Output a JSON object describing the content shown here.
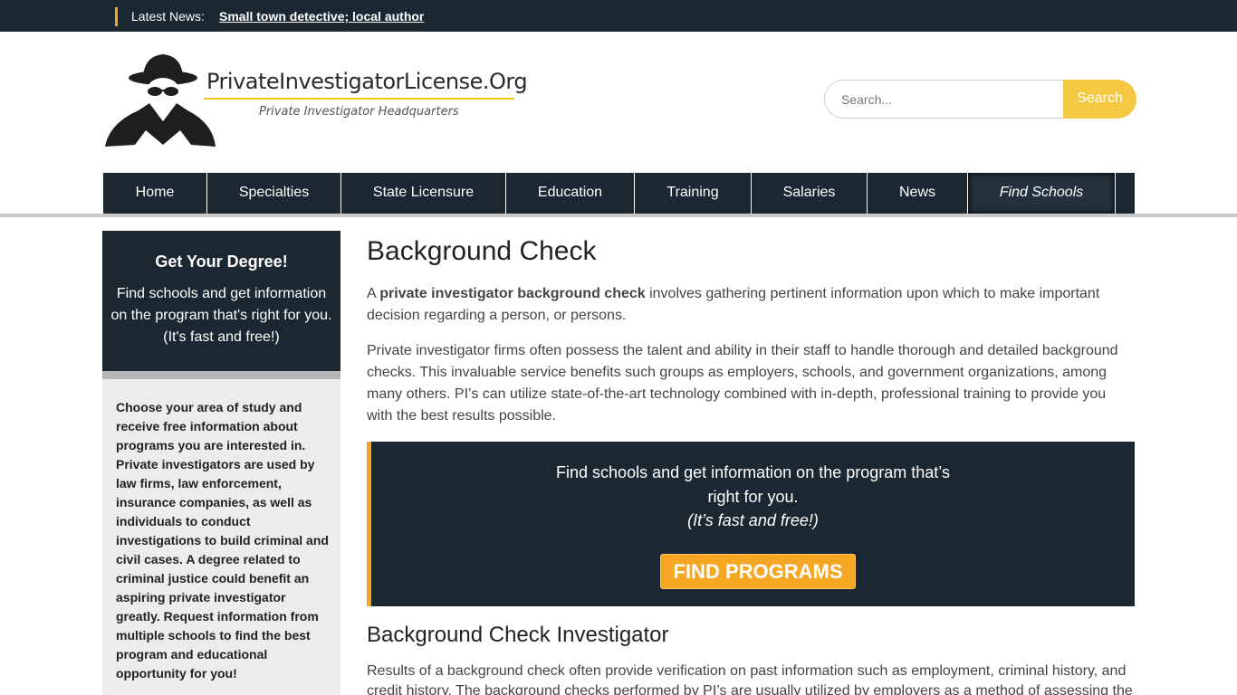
{
  "newsbar": {
    "label": "Latest News:",
    "headline": "Small town detective; local author"
  },
  "header": {
    "logo_title": "PrivateInvestigatorLicense.Org",
    "logo_tagline": "Private Investigator Headquarters",
    "search_placeholder": "Search...",
    "search_button": "Search"
  },
  "nav": {
    "items": [
      "Home",
      "Specialties",
      "State Licensure",
      "Education",
      "Training",
      "Salaries",
      "News",
      "Find Schools"
    ]
  },
  "sidebar": {
    "heading": "Get Your Degree!",
    "subtext": "Find schools and get information on the program that's right for you. (It's fast and free!)",
    "body": "Choose your area of study and receive free information about programs you are interested in. Private investigators are used by law firms, law enforcement, insurance companies, as well as individuals to conduct investigations to build criminal and civil cases. A degree related to criminal justice could benefit an aspiring private investigator greatly. Request information from multiple schools to find the best program and educational opportunity for you!"
  },
  "main": {
    "title": "Background Check",
    "p1_prefix": "A ",
    "p1_bold": "private investigator background check",
    "p1_suffix": " involves gathering pertinent information upon which to make important decision regarding a person, or persons.",
    "p2": "Private investigator firms often possess the talent and ability in their staff to handle thorough and detailed background checks. This invaluable service benefits such groups as employers, schools, and government organizations, among many others. PI’s can utilize state-of-the-art technology combined with in-depth, professional training to provide you with the best results possible.",
    "cta_line1": "Find schools and get information on the program that’s",
    "cta_line2": "right for you.",
    "cta_italic": "(It’s fast and free!)",
    "cta_button": "FIND PROGRAMS",
    "subheading": "Background Check Investigator",
    "p3": "Results of a background check often provide verification on past information such as employment, criminal history, and credit history. The background checks performed by PI’s are usually utilized by employers as a method of assessing the"
  },
  "colors": {
    "dark": "#1c2831",
    "accent_orange": "#f5a623",
    "search_yellow": "#f5c842"
  }
}
